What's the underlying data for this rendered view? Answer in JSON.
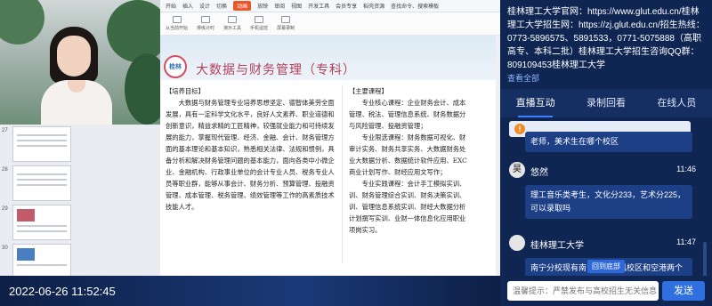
{
  "stage": {
    "ribbon_tabs": [
      "开始",
      "插入",
      "设计",
      "切换",
      "动画",
      "放映",
      "审阅",
      "视图",
      "开发工具",
      "会员专享",
      "稻壳资源",
      "查找命令、搜索模板"
    ],
    "ribbon_buttons": [
      "从当前开始",
      "排练计时",
      "演示工具",
      "手机遥控",
      "屏幕录制"
    ],
    "thumb_numbers": [
      "27",
      "28",
      "29",
      "30"
    ],
    "slide": {
      "logo_text": "桂林",
      "title": "大数据与财务管理（专科）",
      "left_heading": "【培养目标】",
      "left_text": "大数据与财务管理专业培养思想坚定、德智体美劳全面发展，具有一定科学文化水平，良好人文素养、职业道德和创新意识，精益求精的工匠精神，较强就业能力和可持续发展的能力，掌握现代管理、经济、金融、会计、财务管理方面的基本理论和基本知识，熟悉相关法律、法规和惯例，具备分析和解决财务管理问题的基本能力，面向各类中小微企业、金融机构、行政事业单位的会计专业人员、税务专业人员等职业群，能够从事会计、财务分析、预算管理、投融资管理、成本管理、税务管理、绩效管理等工作的高素质技术技能人才。",
      "right_heading": "【主要课程】",
      "right_lines": [
        "专业核心课程：企业财务会计、成本",
        "管理、税法、管理信息系统、财务数据分",
        "与风险管理、投融资管理；",
        "专业限选课程：财务数据可视化、财",
        "审计实务、财务共享实务、大数据财务处",
        "业大数据分析、数据统计软件应用、EXC",
        "商业计划写作、财经应用文写作；",
        "专业实践课程：会计手工模拟实训、",
        "训、财务管理综合实训、财务决策实训、",
        "训、管理信息系统实训、财经大数据分析",
        "计划撰写实训、业财一体信息化应用职业",
        "项岗实习。"
      ]
    },
    "timestamp": "2022-06-26 11:52:45"
  },
  "panel": {
    "info_lines": [
      "桂林理工大学官网：https://www.glut.edu.cn/桂林理工大学招生网：https://zj.glut.edu.cn/招生热线：0773-5896575、5891533，0771-5075888（高职高专、本科二批）桂林理工大学招生咨询QQ群：809109453桂林理工大学"
    ],
    "info_more": "查看全部",
    "tabs": [
      "直播互动",
      "录制回看",
      "在线人员"
    ],
    "chat": {
      "first_bubble": "老师，美术生在哪个校区",
      "messages": [
        {
          "avatar": "昊",
          "name": "悠然",
          "time": "11:46",
          "text": "理工音乐类考生，文化分233，艺术分225，可以录取吗"
        },
        {
          "avatar": "",
          "name": "桂林理工大学",
          "time": "11:47",
          "text": "南宁分校现有南宁分校屏风校区和空港两个校区，现"
        }
      ],
      "back_to_bottom": "回到底部"
    },
    "composer": {
      "placeholder": "温馨提示：严禁发布与高校招生无关信息",
      "send": "发送"
    }
  }
}
